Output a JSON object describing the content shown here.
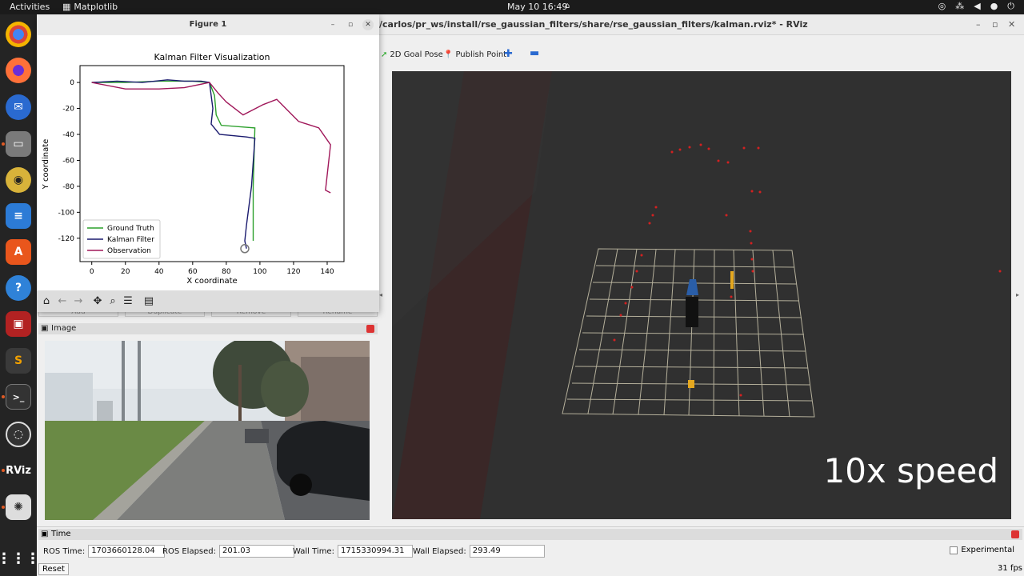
{
  "topbar": {
    "activities": "Activities",
    "app_name": "Matplotlib",
    "clock": "May 10  16:49"
  },
  "rviz": {
    "title": "/carlos/pr_ws/install/rse_gaussian_filters/share/rse_gaussian_filters/kalman.rviz* - RViz",
    "tools": {
      "goal": "2D Goal Pose",
      "publish": "Publish Point"
    },
    "overlay_text": "10x speed",
    "image_panel_title": "Image",
    "time_panel_title": "Time",
    "ros_time_label": "ROS Time:",
    "ros_time": "1703660128.04",
    "ros_elapsed_label": "ROS Elapsed:",
    "ros_elapsed": "201.03",
    "wall_time_label": "Wall Time:",
    "wall_time": "1715330994.31",
    "wall_elapsed_label": "Wall Elapsed:",
    "wall_elapsed": "293.49",
    "experimental": "Experimental",
    "reset": "Reset",
    "fps": "31 fps",
    "hidden_buttons": [
      "Add",
      "Duplicate",
      "Remove",
      "Rename"
    ]
  },
  "figure": {
    "window_title": "Figure 1",
    "colors": {
      "ground_truth": "#2ca02c",
      "kalman": "#1a1a6e",
      "observation": "#a0185a"
    }
  },
  "chart_data": {
    "type": "line",
    "title": "Kalman Filter Visualization",
    "xlabel": "X coordinate",
    "ylabel": "Y coordinate",
    "xlim": [
      -7,
      150
    ],
    "ylim": [
      -138,
      13
    ],
    "xticks": [
      0,
      20,
      40,
      60,
      80,
      100,
      120,
      140
    ],
    "yticks": [
      0,
      -20,
      -40,
      -60,
      -80,
      -100,
      -120
    ],
    "legend_position": "lower-left",
    "series": [
      {
        "name": "Ground Truth",
        "x": [
          0,
          20,
          40,
          60,
          70,
          73,
          74,
          77,
          97,
          96,
          96
        ],
        "y": [
          0,
          0,
          1,
          1,
          0,
          -10,
          -25,
          -33,
          -35,
          -80,
          -122
        ]
      },
      {
        "name": "Kalman Filter",
        "x": [
          0,
          15,
          30,
          45,
          55,
          65,
          70,
          72,
          71,
          76,
          92,
          97,
          95,
          92,
          91,
          92
        ],
        "y": [
          0,
          1,
          0,
          2,
          1,
          1,
          0,
          -20,
          -32,
          -40,
          -42,
          -43,
          -80,
          -110,
          -122,
          -128
        ]
      },
      {
        "name": "Observation",
        "x": [
          0,
          20,
          40,
          55,
          70,
          75,
          80,
          90,
          102,
          110,
          123,
          135,
          142,
          139,
          142
        ],
        "y": [
          0,
          -5,
          -5,
          -4,
          0,
          -8,
          -15,
          -25,
          -17,
          -13,
          -30,
          -35,
          -48,
          -83,
          -85
        ]
      }
    ],
    "marker_point": [
      91,
      -128
    ]
  }
}
